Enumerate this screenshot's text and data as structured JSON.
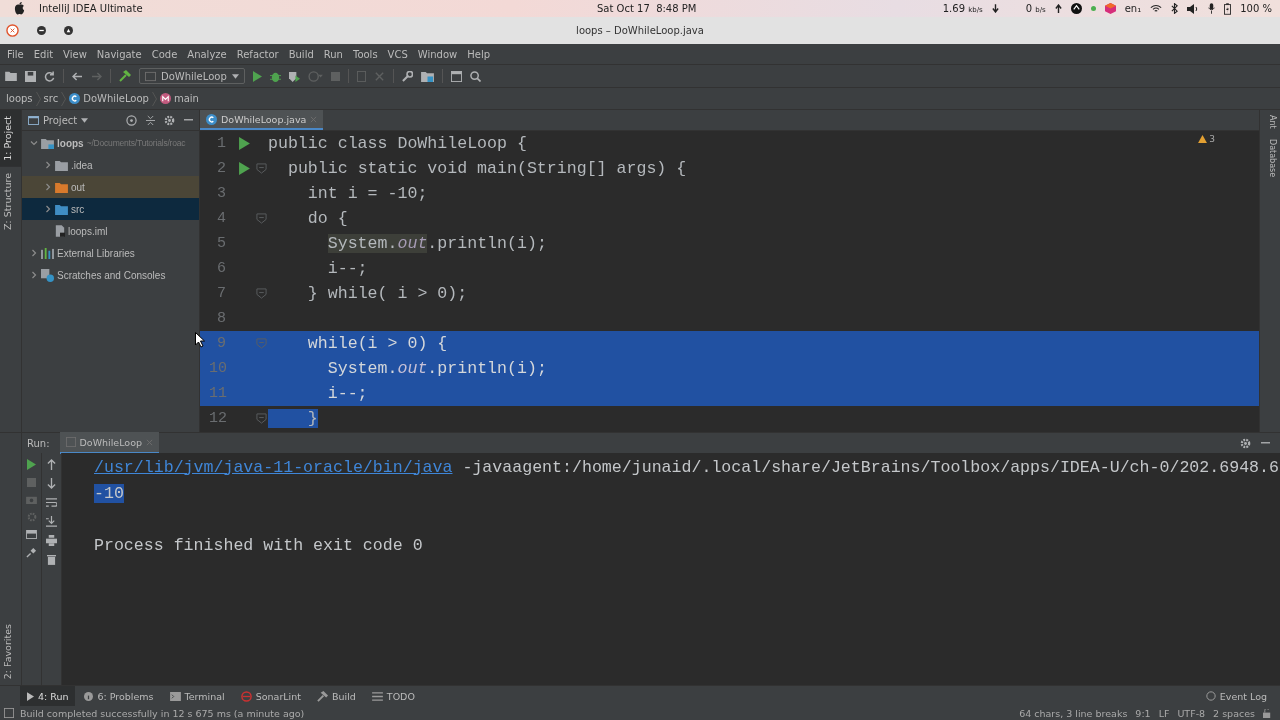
{
  "system_bar": {
    "app": "IntelliJ IDEA Ultimate",
    "clock": "Sat Oct 17  8:48 PM",
    "download": "1.69",
    "download_unit": "kb/s",
    "upload": "0",
    "upload_unit": "b/s",
    "keyboard": "en₁",
    "battery": "100 %"
  },
  "window": {
    "title": "loops – DoWhileLoop.java"
  },
  "menu": [
    "File",
    "Edit",
    "View",
    "Navigate",
    "Code",
    "Analyze",
    "Refactor",
    "Build",
    "Run",
    "Tools",
    "VCS",
    "Window",
    "Help"
  ],
  "toolbar": {
    "run_config": "DoWhileLoop"
  },
  "breadcrumbs": [
    {
      "text": "loops",
      "kind": "plain"
    },
    {
      "text": "src",
      "kind": "plain"
    },
    {
      "text": "DoWhileLoop",
      "kind": "class"
    },
    {
      "text": "main",
      "kind": "method"
    }
  ],
  "left_stripe": [
    {
      "label": "1: Project",
      "selected": true
    },
    {
      "label": "Z: Structure",
      "selected": false
    }
  ],
  "favorites": "2: Favorites",
  "project_panel": {
    "title": "Project",
    "tree": [
      {
        "label": "loops",
        "hint": "~/Documents/Tutorials/roac",
        "kind": "module",
        "expanded": true,
        "selected": false,
        "children": [
          {
            "label": ".idea",
            "kind": "folder",
            "expanded": false,
            "selected": false
          },
          {
            "label": "out",
            "kind": "excluded",
            "expanded": false,
            "selected": false
          },
          {
            "label": "src",
            "kind": "source",
            "expanded": false,
            "selected": true
          },
          {
            "label": "loops.iml",
            "kind": "file",
            "selected": false
          }
        ]
      },
      {
        "label": "External Libraries",
        "kind": "libraries",
        "expanded": false,
        "selected": false
      },
      {
        "label": "Scratches and Consoles",
        "kind": "scratches",
        "expanded": false,
        "selected": false
      }
    ]
  },
  "editor": {
    "tabs": [
      {
        "label": "DoWhileLoop.java",
        "selected": true
      }
    ],
    "warnings": "3",
    "lines": [
      {
        "number": "1",
        "run": true,
        "fold": false,
        "selected": false,
        "tokens": [
          {
            "text": "public class DoWhileLoop {",
            "kind": "plain"
          }
        ]
      },
      {
        "number": "2",
        "run": true,
        "fold": true,
        "selected": false,
        "tokens": [
          {
            "text": "  public static void main(String[] args) {",
            "kind": "plain"
          }
        ]
      },
      {
        "number": "3",
        "run": false,
        "fold": false,
        "selected": false,
        "tokens": [
          {
            "text": "    int i = -10;",
            "kind": "plain"
          }
        ]
      },
      {
        "number": "4",
        "run": false,
        "fold": true,
        "selected": false,
        "tokens": [
          {
            "text": "    do {",
            "kind": "plain"
          }
        ]
      },
      {
        "number": "5",
        "run": false,
        "fold": false,
        "selected": false,
        "tokens": [
          {
            "text": "      System.",
            "kind": "usage"
          },
          {
            "text": "out",
            "kind": "usage-field"
          },
          {
            "text": ".println(i);",
            "kind": "plain"
          }
        ]
      },
      {
        "number": "6",
        "run": false,
        "fold": false,
        "selected": false,
        "tokens": [
          {
            "text": "      i--;",
            "kind": "plain"
          }
        ]
      },
      {
        "number": "7",
        "run": false,
        "fold": true,
        "selected": false,
        "tokens": [
          {
            "text": "    } while( i > 0);",
            "kind": "plain"
          }
        ]
      },
      {
        "number": "8",
        "run": false,
        "fold": false,
        "selected": false
      },
      {
        "number": "9",
        "run": false,
        "fold": true,
        "selected": true,
        "tokens": [
          {
            "text": "    while(i > 0) {",
            "kind": "plain"
          }
        ]
      },
      {
        "number": "10",
        "run": false,
        "fold": false,
        "selected": true,
        "tokens": [
          {
            "text": "      System.",
            "kind": "plain"
          },
          {
            "text": "out",
            "kind": "field"
          },
          {
            "text": ".println(i);",
            "kind": "plain"
          }
        ]
      },
      {
        "number": "11",
        "run": false,
        "fold": false,
        "selected": true,
        "tokens": [
          {
            "text": "      i--;",
            "kind": "plain"
          }
        ]
      },
      {
        "number": "12",
        "run": false,
        "fold": true,
        "selected": true,
        "tokens": [
          {
            "text": "    }",
            "kind": "plain"
          }
        ]
      }
    ]
  },
  "right_stripe": [
    "Ant",
    "Database"
  ],
  "run_panel": {
    "label": "Run:",
    "tab": "DoWhileLoop",
    "command_link": "/usr/lib/jvm/java-11-oracle/bin/java",
    "command_args": " -javaagent:/home/junaid/.local/share/JetBrains/Toolbox/apps/IDEA-U/ch-0/202.6948.6",
    "output": {
      "text": "-10",
      "selected": true
    },
    "exit": "Process finished with exit code 0"
  },
  "tool_tabs": [
    {
      "label": "4: Run",
      "kind": "run",
      "selected": true
    },
    {
      "label": "6: Problems",
      "kind": "problems",
      "selected": false
    },
    {
      "label": "Terminal",
      "kind": "terminal",
      "selected": false
    },
    {
      "label": "SonarLint",
      "kind": "sonar",
      "selected": false
    },
    {
      "label": "Build",
      "kind": "build",
      "selected": false
    },
    {
      "label": "TODO",
      "kind": "todo",
      "selected": false
    }
  ],
  "event_log": "Event Log",
  "status_bar": {
    "message": "Build completed successfully in 12 s 675 ms (a minute ago)",
    "items": [
      "64 chars, 3 line breaks",
      "9:1",
      "LF",
      "UTF-8",
      "2 spaces"
    ]
  }
}
